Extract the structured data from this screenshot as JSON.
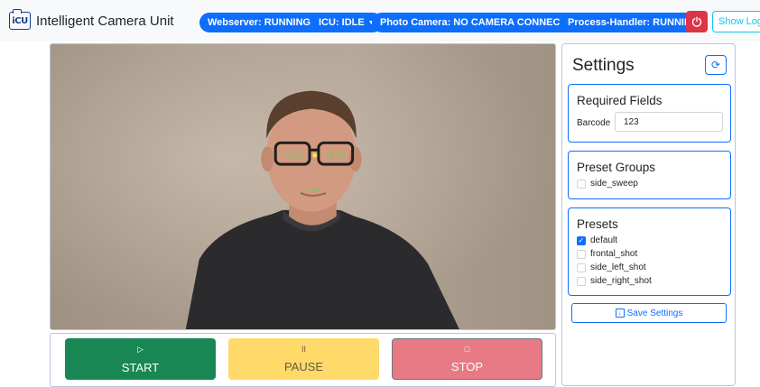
{
  "app": {
    "logo_text": "iCU",
    "title": "Intelligent Camera Unit"
  },
  "status_bar": {
    "webserver": "Webserver: RUNNING",
    "icu": "ICU: IDLE",
    "photo_camera": "Photo Camera: NO CAMERA CONNECTED",
    "process_handler": "Process-Handler: RUNNING",
    "show_logs": "Show Logs",
    "power_icon": "power-icon"
  },
  "controls": {
    "start": "START",
    "pause": "PAUSE",
    "stop": "STOP"
  },
  "settings": {
    "title": "Settings",
    "refresh_icon": "refresh-icon",
    "required_fields": {
      "title": "Required Fields",
      "barcode_label": "Barcode",
      "barcode_value": "123"
    },
    "preset_groups": {
      "title": "Preset Groups",
      "items": [
        {
          "label": "side_sweep",
          "checked": false
        }
      ]
    },
    "presets": {
      "title": "Presets",
      "items": [
        {
          "label": "default",
          "checked": true
        },
        {
          "label": "frontal_shot",
          "checked": false
        },
        {
          "label": "side_left_shot",
          "checked": false
        },
        {
          "label": "side_right_shot",
          "checked": false
        }
      ]
    },
    "save_label": "Save Settings"
  },
  "colors": {
    "primary": "#0d6efd",
    "danger": "#dc3545",
    "success": "#198754",
    "warning": "#ffda6a",
    "info": "#0dcaf0"
  }
}
